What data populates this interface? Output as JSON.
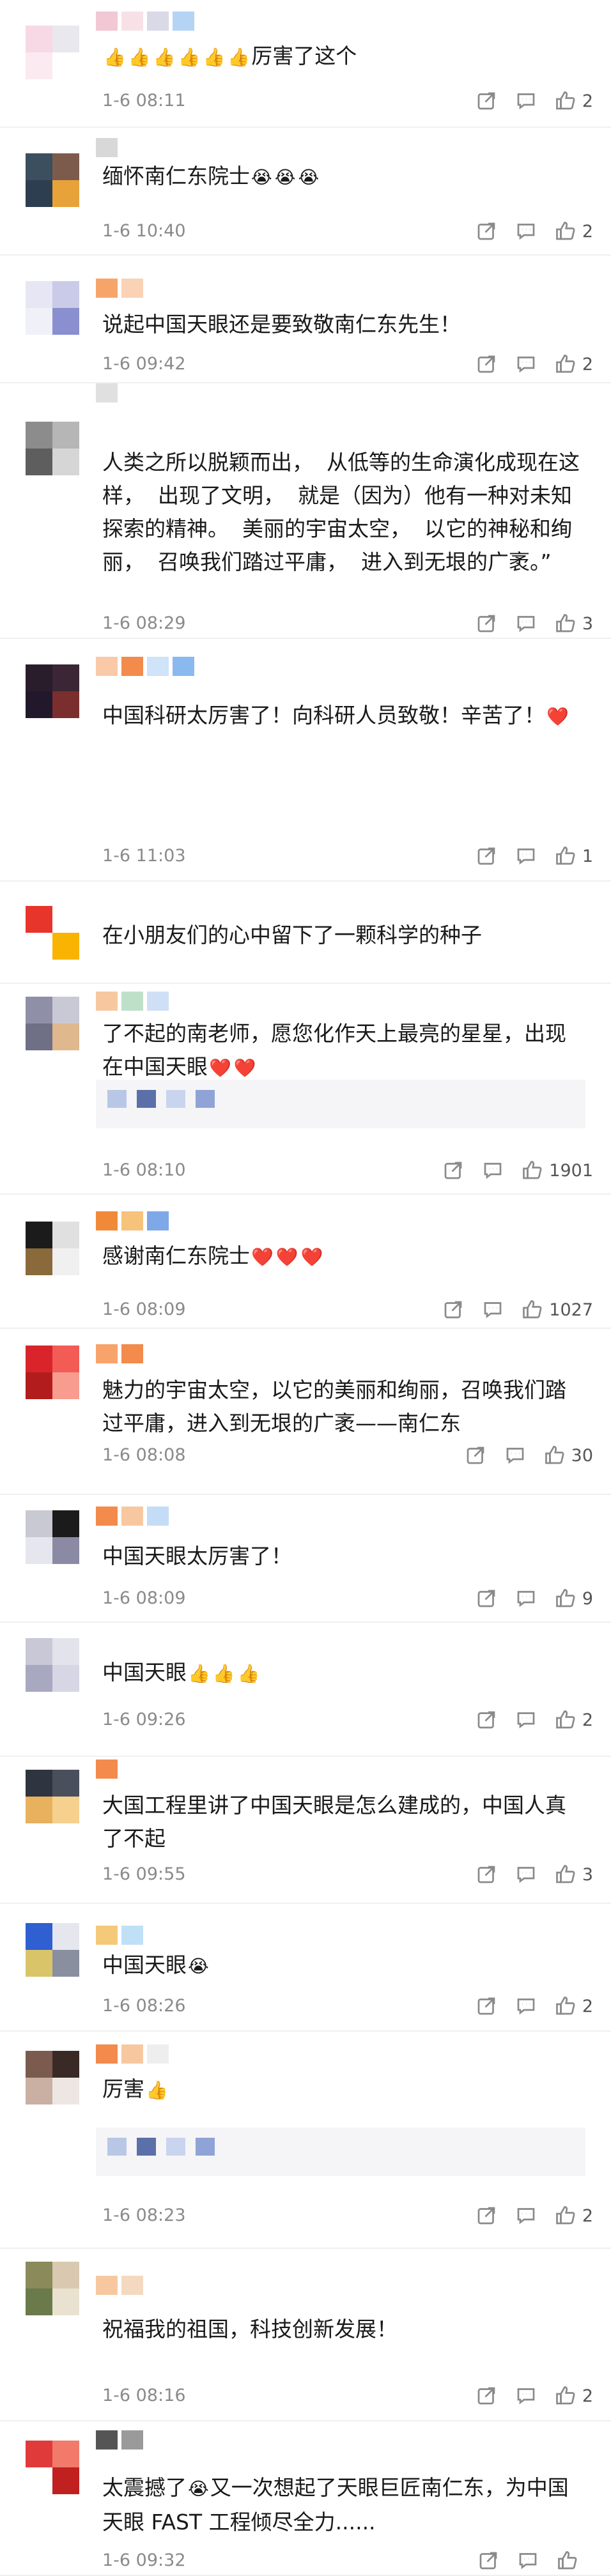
{
  "comments": [
    {
      "text": "",
      "tail": "厉害了这个",
      "emojis": [
        "👍",
        "👍",
        "👍",
        "👍",
        "👍",
        "👍"
      ],
      "time": "1-6 08:11",
      "likes": "2",
      "avatar_colors": [
        "#f7d9e5",
        "#e8e8ee",
        "#fbeaf0",
        "#ffffff"
      ],
      "name_colors": [
        "#f1c8d4",
        "#f7e1e7",
        "#d9d9e8",
        "#b5d3f5"
      ]
    },
    {
      "text": "缅怀南仁东院士",
      "tail": "",
      "emojis": [
        "😭",
        "😭",
        "😭"
      ],
      "time": "1-6 10:40",
      "likes": "2",
      "avatar_colors": [
        "#3b4f5e",
        "#7d5b4c",
        "#2c3e50",
        "#e8a23a"
      ],
      "name_colors": [
        "#d8d8d8"
      ]
    },
    {
      "text": "说起中国天眼还是要致敬南仁东先生！",
      "tail": "",
      "emojis": [],
      "time": "1-6 09:42",
      "likes": "2",
      "avatar_colors": [
        "#e6e6f4",
        "#c9cbe8",
        "#f0f0f8",
        "#8a8fcf"
      ],
      "name_colors": [
        "#f6a46a",
        "#fad2b5"
      ]
    },
    {
      "text": "人类之所以脱颖而出，  从低等的生命演化成现在这样，  出现了文明，  就是（因为）他有一种对未知探索的精神。  美丽的宇宙太空，  以它的神秘和绚丽，  召唤我们踏过平庸，  进入到无垠的广袤。”",
      "tail": "",
      "emojis": [],
      "time": "1-6 08:29",
      "likes": "3",
      "avatar_colors": [
        "#8c8c8c",
        "#b6b6b6",
        "#5e5e5e",
        "#d6d6d6"
      ],
      "name_colors": [
        "#e0e0e0"
      ]
    },
    {
      "text": "中国科研太厉害了！向科研人员致敬！辛苦了！",
      "tail": "",
      "emojis": [
        "❤️"
      ],
      "time": "1-6 11:03",
      "likes": "1",
      "avatar_colors": [
        "#2a1d2b",
        "#3a2634",
        "#21182b",
        "#7a2e2e"
      ],
      "name_colors": [
        "#f9c9a8",
        "#f28b4c",
        "#cfe3f9",
        "#8ab9f0"
      ]
    },
    {
      "text": "在小朋友们的心中留下了一颗科学的种子",
      "tail": "",
      "emojis": [],
      "time": "",
      "likes": "",
      "avatar_colors": [
        "#e8352b",
        "#ffffff",
        "#ffffff",
        "#f8b400"
      ],
      "name_colors": []
    },
    {
      "text": "了不起的南老师，愿您化作天上最亮的星星，出现在中国天眼",
      "tail": "",
      "emojis": [
        "❤️",
        "❤️"
      ],
      "time": "1-6 08:10",
      "likes": "1901",
      "avatar_colors": [
        "#8f8fa8",
        "#c9c9d6",
        "#6f6f86",
        "#e0b88e"
      ],
      "name_colors": [
        "#f7c8a0",
        "#bfe0c8",
        "#cfe0f6"
      ]
    },
    {
      "text": "感谢南仁东院士",
      "tail": "",
      "emojis": [
        "❤️",
        "❤️",
        "❤️"
      ],
      "time": "1-6 08:09",
      "likes": "1027",
      "avatar_colors": [
        "#1b1b1b",
        "#e0e0e0",
        "#8a6a3a",
        "#f0f0f0"
      ],
      "name_colors": [
        "#f08a3a",
        "#f7c27a",
        "#7fa8e8"
      ]
    },
    {
      "text": "魅力的宇宙太空，以它的美丽和绚丽，召唤我们踏过平庸，进入到无垠的广袤——南仁东",
      "tail": "",
      "emojis": [],
      "time": "1-6 08:08",
      "likes": "30",
      "avatar_colors": [
        "#d9242b",
        "#f25c54",
        "#b31c1c",
        "#f79c8f"
      ],
      "name_colors": [
        "#f7a36b",
        "#f28b4c"
      ]
    },
    {
      "text": "中国天眼太厉害了！",
      "tail": "",
      "emojis": [],
      "time": "1-6 08:09",
      "likes": "9",
      "avatar_colors": [
        "#c9c9d3",
        "#1b1b1b",
        "#e6e6ee",
        "#8a8aa5"
      ],
      "name_colors": [
        "#f28b4c",
        "#f7c8a0",
        "#c5dcf6"
      ]
    },
    {
      "text": "中国天眼",
      "tail": "",
      "emojis": [
        "👍",
        "👍",
        "👍"
      ],
      "time": "1-6 09:26",
      "likes": "2",
      "avatar_colors": [
        "#c8c8d6",
        "#e3e3ec",
        "#a8a8c0",
        "#d6d6e4"
      ],
      "name_colors": []
    },
    {
      "text": "大国工程里讲了中国天眼是怎么建成的，中国人真了不起",
      "tail": "",
      "emojis": [],
      "time": "1-6 09:55",
      "likes": "3",
      "avatar_colors": [
        "#2e3440",
        "#4a4f5c",
        "#e8b15e",
        "#f6d08f"
      ],
      "name_colors": [
        "#f28b4c"
      ]
    },
    {
      "text": "中国天眼",
      "tail": "",
      "emojis": [
        "😭"
      ],
      "time": "1-6 08:26",
      "likes": "2",
      "avatar_colors": [
        "#2f5fd0",
        "#e6e6ee",
        "#d9c46a",
        "#8a8fa0"
      ],
      "name_colors": [
        "#f4c97a",
        "#bfe0f6"
      ]
    },
    {
      "text": "厉害",
      "tail": "",
      "emojis": [
        "👍"
      ],
      "time": "1-6 08:23",
      "likes": "2",
      "avatar_colors": [
        "#7a5b4e",
        "#3a2a25",
        "#c9b0a3",
        "#eee6e2"
      ],
      "name_colors": [
        "#f28b4c",
        "#f7c8a0",
        "#eeeeee"
      ]
    },
    {
      "text": "祝福我的祖国，科技创新发展！",
      "tail": "",
      "emojis": [],
      "time": "1-6 08:16",
      "likes": "2",
      "avatar_colors": [
        "#8a8a5a",
        "#d9c9b0",
        "#6a7a4a",
        "#eae2d0"
      ],
      "name_colors": [
        "#f7c8a0",
        "#f4d9c0"
      ]
    },
    {
      "text": "太震撼了",
      "tail": "又一次想起了天眼巨匠南仁东，为中国天眼 FAST 工程倾尽全力......",
      "emojis": [
        "😭"
      ],
      "time": "1-6 09:32",
      "likes": "",
      "avatar_colors": [
        "#e03a3a",
        "#f27a6a",
        "#ffffff",
        "#c02020"
      ],
      "name_colors": [
        "#555555",
        "#9a9a9a"
      ]
    }
  ]
}
